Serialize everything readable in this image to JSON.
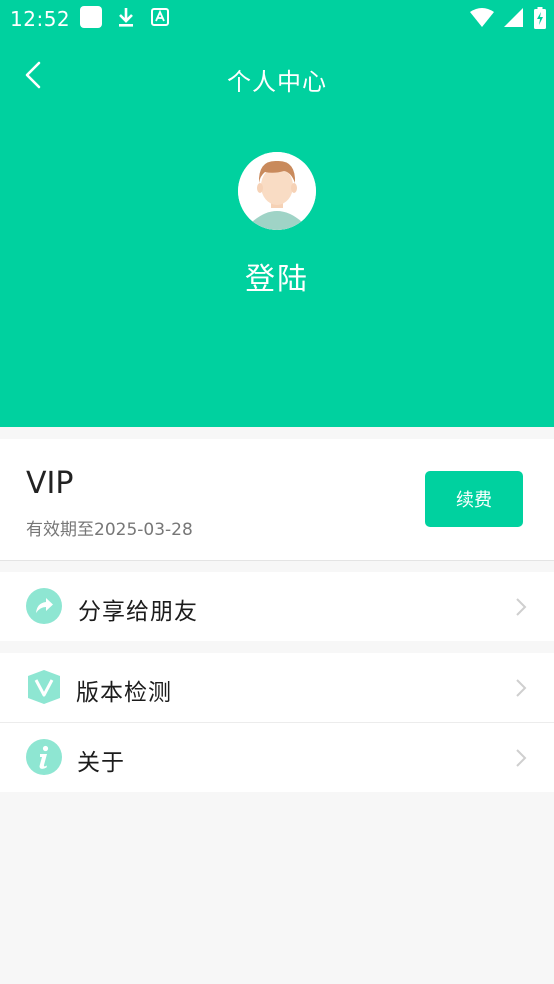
{
  "status_bar": {
    "time": "12:52"
  },
  "header": {
    "title": "个人中心",
    "login_label": "登陆"
  },
  "vip": {
    "title": "VIP",
    "expiry": "有效期至2025-03-28",
    "renew_label": "续费"
  },
  "menu": {
    "share_label": "分享给朋友",
    "version_label": "版本检测",
    "about_label": "关于"
  },
  "colors": {
    "accent": "#00d19f",
    "icon_light": "#8ee6d2"
  }
}
